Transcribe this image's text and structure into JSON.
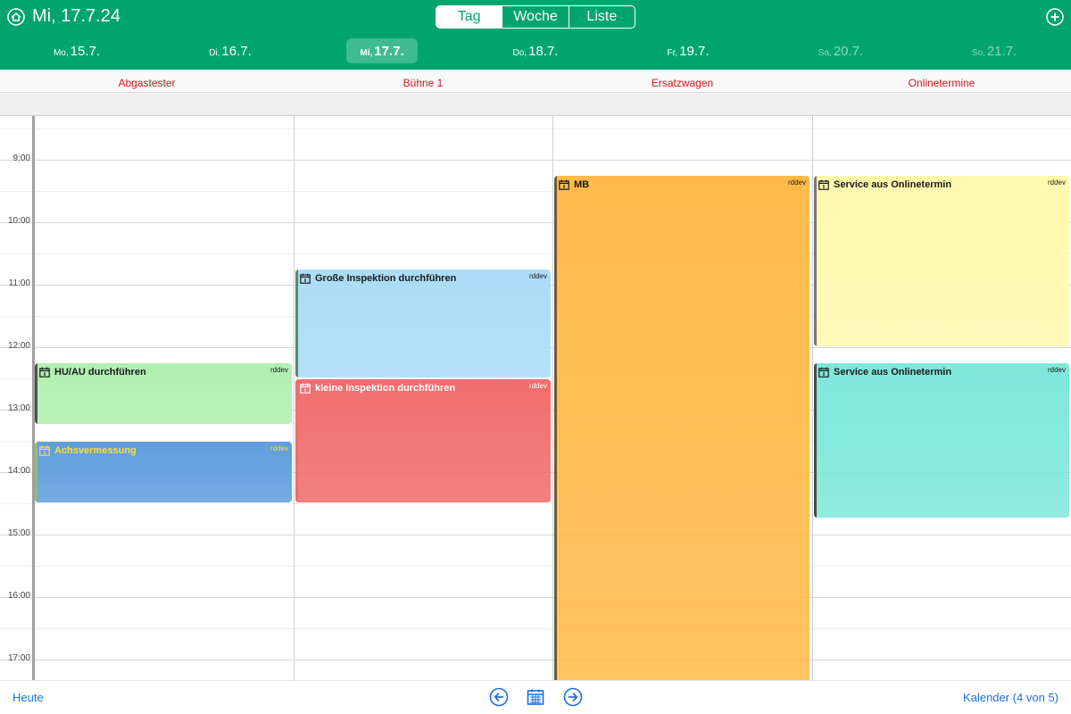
{
  "header": {
    "date": "Mi, 17.7.24",
    "views": [
      "Tag",
      "Woche",
      "Liste"
    ],
    "active_view": "Tag",
    "days": [
      {
        "name": "Mo,",
        "date": "15.7."
      },
      {
        "name": "Di,",
        "date": "16.7."
      },
      {
        "name": "Mi,",
        "date": "17.7."
      },
      {
        "name": "Do,",
        "date": "18.7."
      },
      {
        "name": "Fr,",
        "date": "19.7."
      },
      {
        "name": "Sa,",
        "date": "20.7."
      },
      {
        "name": "So,",
        "date": "21.7."
      }
    ],
    "active_day": 2,
    "weekend_days": [
      5,
      6
    ]
  },
  "resources": [
    "Abgastester",
    "Bühne 1",
    "Ersatzwagen",
    "Onlinetermine"
  ],
  "time_labels": [
    "9:00",
    "10:00",
    "11:00",
    "12:00",
    "13:00",
    "14:00",
    "15:00",
    "16:00",
    "17:00"
  ],
  "view_start_hour": 8.3,
  "events": [
    {
      "title": "HU/AU durchführen",
      "owner": "rddev",
      "resource": 0,
      "start": 12.25,
      "end": 13.25,
      "color": "#b0f0b0",
      "text_color": "#1a1a1a",
      "bar_color": "#505050"
    },
    {
      "title": "Achsvermessung",
      "owner": "rddev",
      "resource": 0,
      "start": 13.5,
      "end": 14.5,
      "color": "#5f9edc",
      "text_color": "#ffe033",
      "bar_color": "#8fc06f"
    },
    {
      "title": "Große Inspektion durchführen",
      "owner": "rddev",
      "resource": 1,
      "start": 10.75,
      "end": 12.5,
      "color": "#abdcf8",
      "text_color": "#1a1a1a",
      "bar_color": "#4c8f6b"
    },
    {
      "title": "kleine Inspektion durchführen",
      "owner": "rddev",
      "resource": 1,
      "start": 12.5,
      "end": 14.5,
      "color": "#f16d6d",
      "text_color": "#ffffff",
      "bar_color": "#f16d6d"
    },
    {
      "title": "MB",
      "owner": "rddev",
      "resource": 2,
      "start": 9.25,
      "end": 17.5,
      "color": "#ffbb4a",
      "text_color": "#1a1a1a",
      "bar_color": "#6b5a3a"
    },
    {
      "title": "Service aus Onlinetermin",
      "owner": "rddev",
      "resource": 3,
      "start": 9.25,
      "end": 12.0,
      "color": "#fffaae",
      "text_color": "#1a1a1a",
      "bar_color": "#777777"
    },
    {
      "title": "Service aus Onlinetermin",
      "owner": "rddev",
      "resource": 3,
      "start": 12.25,
      "end": 14.75,
      "color": "#7ee8db",
      "text_color": "#1a1a1a",
      "bar_color": "#4a4a4a"
    }
  ],
  "footer": {
    "today_label": "Heute",
    "calendar_count": "Kalender (4 von 5)"
  },
  "colors": {
    "header_bg": "#00a56d",
    "resource_label": "#d8161b",
    "link": "#1e6fd9"
  }
}
